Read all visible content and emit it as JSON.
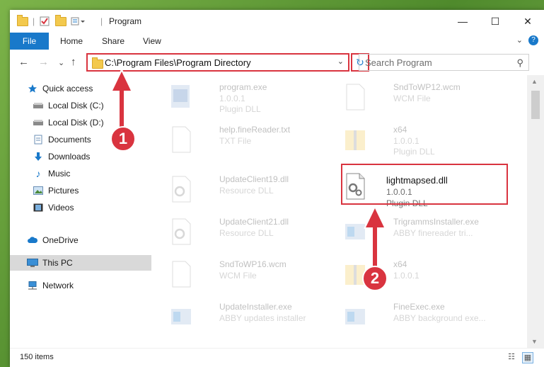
{
  "window": {
    "title": "Program",
    "minimize_glyph": "—",
    "maximize_glyph": "☐",
    "close_glyph": "✕"
  },
  "ribbon": {
    "tabs": [
      "File",
      "Home",
      "Share",
      "View"
    ],
    "collapse_glyph": "⌄",
    "help_glyph": "?"
  },
  "navigation": {
    "back_glyph": "←",
    "forward_glyph": "→",
    "recent_glyph": "⌄",
    "up_glyph": "↑",
    "address": "C:\\Program Files\\Program Directory",
    "address_dropdown_glyph": "⌄",
    "refresh_glyph": "↻",
    "search_placeholder": "Search Program",
    "search_glyph": "⚲"
  },
  "nav_pane": {
    "quick_access": "Quick access",
    "items": [
      {
        "label": "Local Disk (C:)"
      },
      {
        "label": "Local Disk (D:)"
      },
      {
        "label": "Documents"
      },
      {
        "label": "Downloads"
      },
      {
        "label": "Music"
      },
      {
        "label": "Pictures"
      },
      {
        "label": "Videos"
      }
    ],
    "onedrive": "OneDrive",
    "this_pc": "This PC",
    "network": "Network"
  },
  "files": [
    {
      "name": "program.exe",
      "line2": "1.0.0.1",
      "line3": "Plugin DLL"
    },
    {
      "name": "SndToWP12.wcm",
      "line2": "WCM File",
      "line3": ""
    },
    {
      "name": "help.fineReader.txt",
      "line2": "TXT File",
      "line3": ""
    },
    {
      "name": "x64",
      "line2": "1.0.0.1",
      "line3": "Plugin DLL"
    },
    {
      "name": "UpdateClient19.dll",
      "line2": "Resource DLL",
      "line3": ""
    },
    {
      "name": "lightmapsed.dll",
      "line2": "1.0.0.1",
      "line3": "Plugin DLL"
    },
    {
      "name": "UpdateClient21.dll",
      "line2": "Resource DLL",
      "line3": ""
    },
    {
      "name": "TrigrammsInstaller.exe",
      "line2": "ABBY finereader tri...",
      "line3": ""
    },
    {
      "name": "SndToWP16.wcm",
      "line2": "WCM File",
      "line3": ""
    },
    {
      "name": "x64",
      "line2": "1.0.0.1",
      "line3": ""
    },
    {
      "name": "UpdateInstaller.exe",
      "line2": "ABBY updates installer",
      "line3": ""
    },
    {
      "name": "FineExec.exe",
      "line2": "ABBY background exe...",
      "line3": ""
    }
  ],
  "callouts": [
    "1",
    "2"
  ],
  "status": {
    "item_count": "150 items"
  },
  "colors": {
    "accent": "#1979ca",
    "highlight": "#d9343f"
  }
}
